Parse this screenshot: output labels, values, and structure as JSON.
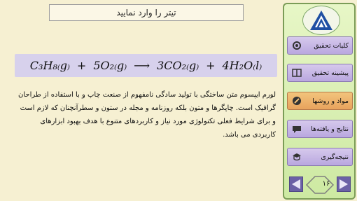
{
  "slide": {
    "title": "تیتر را وارد نمایید",
    "equation": {
      "reactant_1": "C₃H₈₍g₎",
      "plus_1": "+",
      "reactant_2": "5O₂₍g₎",
      "arrow": "⟶",
      "product_1": "3CO₂₍g₎",
      "plus_2": "+",
      "product_2": "4H₂O₍l₎"
    },
    "body": "لورم ایپسوم متن ساختگی با تولید سادگی نامفهوم از صنعت چاپ و با استفاده از طراحان گرافیک است. چاپگرها و متون بلکه روزنامه و مجله در ستون و سطرآنچنان که لازم است و برای شرایط فعلی تکنولوژی مورد نیاز و کاربردهای متنوع با هدف بهبود ابزارهای کاربردی می باشد."
  },
  "sidebar": {
    "menu": [
      {
        "label": "کلیات تحقیق",
        "icon": "settings-icon",
        "active": false
      },
      {
        "label": "پیشینه تحقیق",
        "icon": "book-icon",
        "active": false
      },
      {
        "label": "مواد و روشها",
        "icon": "tools-icon",
        "active": true
      },
      {
        "label": "نتایج و یافته‌ها",
        "icon": "chat-icon",
        "active": false
      },
      {
        "label": "نتیجه‌گیری",
        "icon": "graduation-icon",
        "active": false
      }
    ],
    "page_number": "۱۶"
  },
  "colors": {
    "background": "#f6f0d2",
    "menu_button": "#c6b7e4",
    "menu_active": "#eeb06a",
    "sidebar": "#d9efb4",
    "equation_bg": "#d7d1ec",
    "nav_arrow": "#6b61a6"
  }
}
